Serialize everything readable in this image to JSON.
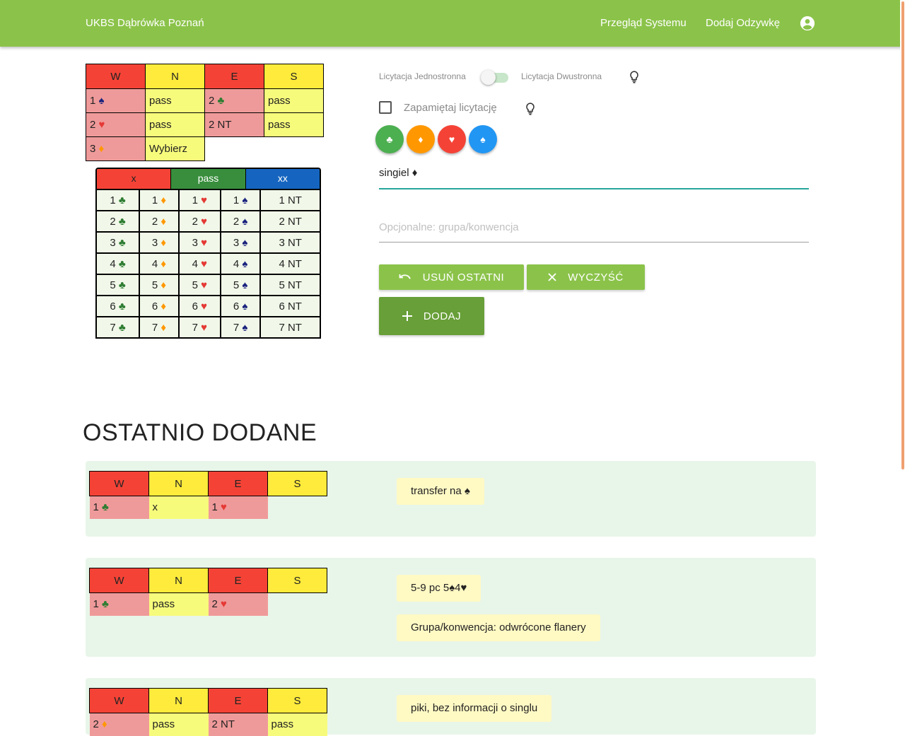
{
  "topbar": {
    "brand": "UKBS Dąbrówka Poznań",
    "nav": [
      "Przegląd Systemu",
      "Dodaj Odzywkę"
    ],
    "account_icon": "account-circle-icon"
  },
  "bidding": {
    "headers": [
      "W",
      "N",
      "E",
      "S"
    ],
    "rows": [
      [
        {
          "level": "1",
          "suit": "♠",
          "cls": "spade"
        },
        {
          "level": "pass"
        },
        {
          "level": "2",
          "suit": "♣",
          "cls": "club"
        },
        {
          "level": "pass"
        }
      ],
      [
        {
          "level": "2",
          "suit": "♥",
          "cls": "heart"
        },
        {
          "level": "pass"
        },
        {
          "level": "2 NT"
        },
        {
          "level": "pass"
        }
      ],
      [
        {
          "level": "3",
          "suit": "♦",
          "cls": "dia"
        },
        {
          "level": "Wybierz"
        }
      ]
    ]
  },
  "picker": {
    "top": [
      "x",
      "pass",
      "xx"
    ],
    "levels": [
      "1",
      "2",
      "3",
      "4",
      "5",
      "6",
      "7"
    ],
    "suits": [
      {
        "sym": "♣",
        "cls": "club"
      },
      {
        "sym": "♦",
        "cls": "dia"
      },
      {
        "sym": "♥",
        "cls": "heart"
      },
      {
        "sym": "♠",
        "cls": "spade"
      },
      {
        "sym": "NT",
        "cls": ""
      }
    ]
  },
  "form": {
    "toggle_left": "Licytacja Jednostronna",
    "toggle_right": "Licytacja Dwustronna",
    "remember_label": "Zapamiętaj licytację",
    "suit_buttons": [
      {
        "sym": "♣",
        "color": "#4caf50"
      },
      {
        "sym": "♦",
        "color": "#ff9800"
      },
      {
        "sym": "♥",
        "color": "#f44336"
      },
      {
        "sym": "♠",
        "color": "#2196f3"
      }
    ],
    "meaning_value": "singiel ♦",
    "group_placeholder": "Opcjonalne: grupa/konwencja",
    "undo_label": "USUŃ OSTATNI",
    "clear_label": "WYCZYŚĆ",
    "add_label": "DODAJ"
  },
  "recent": {
    "title": "OSTATNIO DODANE",
    "items": [
      {
        "bids": [
          {
            "level": "1",
            "suit": "♣",
            "cls": "club"
          },
          {
            "level": "x"
          },
          {
            "level": "1",
            "suit": "♥",
            "cls": "heart"
          }
        ],
        "notes": [
          "transfer na ♠"
        ]
      },
      {
        "bids": [
          {
            "level": "1",
            "suit": "♣",
            "cls": "club"
          },
          {
            "level": "pass"
          },
          {
            "level": "2",
            "suit": "♥",
            "cls": "heart"
          }
        ],
        "notes": [
          "5-9 pc 5♠4♥",
          "Grupa/konwencja: odwrócone flanery"
        ]
      },
      {
        "bids": [
          {
            "level": "2",
            "suit": "♦",
            "cls": "dia"
          },
          {
            "level": "pass"
          },
          {
            "level": "2 NT"
          },
          {
            "level": "pass"
          }
        ],
        "notes": [
          "piki, bez informacji o singlu"
        ]
      }
    ]
  }
}
